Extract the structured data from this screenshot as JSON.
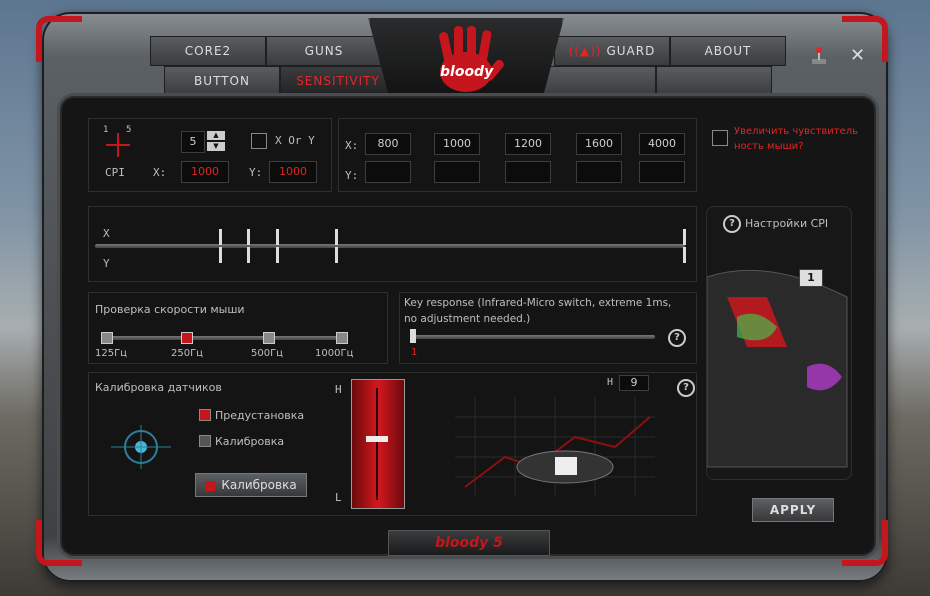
{
  "tabs": {
    "core2": "CORE2",
    "guns": "GUNS",
    "button": "BUTTON",
    "sensitivity": "SENSITIVITY",
    "guard": "GUARD",
    "about": "ABOUT"
  },
  "logo_text": "bloody",
  "footer_logo": "bloody 5",
  "cpi": {
    "level_label_1": "1",
    "level_label_5": "5",
    "level_value": "5",
    "x_or_y_label": "X Or Y",
    "cpi_label": "CPI",
    "x_label": "X:",
    "y_label": "Y:",
    "x_value": "1000",
    "y_value": "1000"
  },
  "cpi_table": {
    "x_label": "X:",
    "y_label": "Y:",
    "x_values": [
      "800",
      "1000",
      "1200",
      "1600",
      "4000"
    ],
    "y_values": [
      "",
      "",
      "",
      "",
      ""
    ]
  },
  "enhance_checkbox_label": "Увеличить чувствитель ность мыши?",
  "cpi_settings_label": "Настройки CPI",
  "cpi_slider": {
    "x_axis": "X",
    "y_axis": "Y"
  },
  "polling": {
    "title": "Проверка скорости мыши",
    "options": [
      "125Гц",
      "250Гц",
      "500Гц",
      "1000Гц"
    ],
    "selected_index": 1
  },
  "key_response": {
    "text": "Key response (Infrared-Micro switch, extreme 1ms, no adjustment needed.)",
    "value": "1"
  },
  "calibration": {
    "title": "Калибровка датчиков",
    "preset_label": "Предустановка",
    "calibrate_label": "Калибровка",
    "button_label": "Калибровка",
    "h_label": "H",
    "l_label": "L",
    "h_value": "9"
  },
  "cpi_badge": "1",
  "apply_label": "APPLY",
  "colors": {
    "accent": "#e02525",
    "panel": "#141414"
  }
}
